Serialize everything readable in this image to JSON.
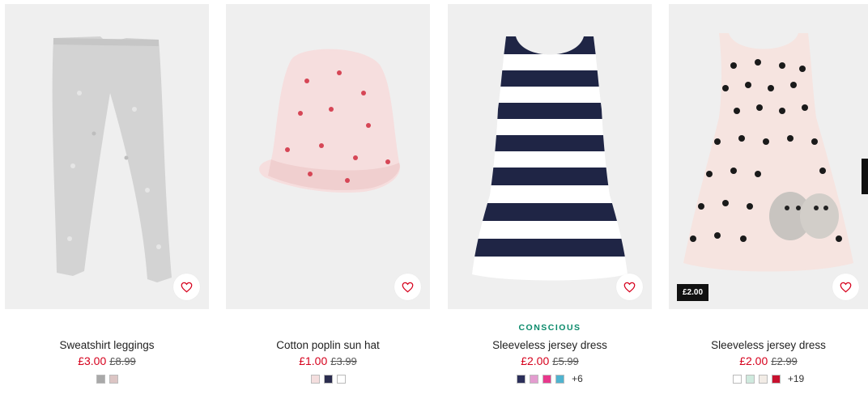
{
  "products": [
    {
      "tag": "",
      "title": "Sweatshirt leggings",
      "price": "£3.00",
      "old_price": "£8.99",
      "badge": "",
      "swatches": [
        "#a9a9a9",
        "#dcc5c4"
      ],
      "more": ""
    },
    {
      "tag": "",
      "title": "Cotton poplin sun hat",
      "price": "£1.00",
      "old_price": "£3.99",
      "badge": "",
      "swatches": [
        "#f4dede",
        "#2b2d4f",
        "#ffffff"
      ],
      "more": ""
    },
    {
      "tag": "CONSCIOUS",
      "title": "Sleeveless jersey dress",
      "price": "£2.00",
      "old_price": "£5.99",
      "badge": "",
      "swatches": [
        "#2b2f5a",
        "#e39ccf",
        "#e8388c",
        "#4fb3cf"
      ],
      "more": "+6"
    },
    {
      "tag": "",
      "title": "Sleeveless jersey dress",
      "price": "£2.00",
      "old_price": "£2.99",
      "badge": "£2.00",
      "swatches": [
        "#ffffff",
        "#cfeade",
        "#f2ece6",
        "#c8102e"
      ],
      "more": "+19"
    }
  ],
  "icons": {
    "favourite": "heart-outline-icon"
  },
  "colors": {
    "sale_price": "#d6001c",
    "conscious_tag": "#0a8a6b"
  }
}
